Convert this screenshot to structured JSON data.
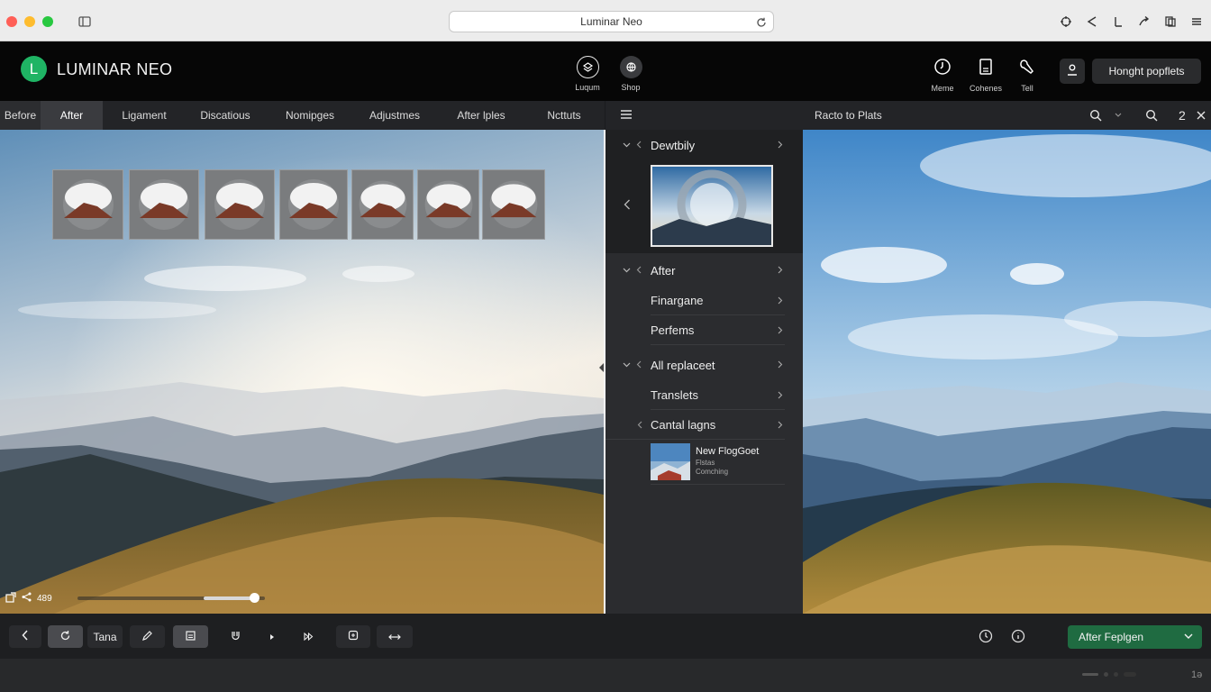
{
  "browser": {
    "url_title": "Luminar Neo",
    "icons": [
      "sidebar-icon",
      "reload-icon",
      "extensions-icon",
      "share-icon",
      "bookmark-icon",
      "forward-icon",
      "tabs-icon",
      "menu-icon"
    ]
  },
  "app": {
    "logo_letter": "L",
    "name": "LUMINAR NEO",
    "brand_color": "#1fb464",
    "center_tools": [
      {
        "label": "Luqum",
        "icon": "layers-icon"
      },
      {
        "label": "Shop",
        "icon": "globe-icon"
      }
    ],
    "right_tools": [
      {
        "label": "Meme",
        "icon": "history-icon"
      },
      {
        "label": "Cohenes",
        "icon": "document-icon"
      },
      {
        "label": "Tell",
        "icon": "brush-icon"
      }
    ],
    "account_icon": "user-icon",
    "primary_button": "Honght popflets"
  },
  "tabs": [
    {
      "label": "Before"
    },
    {
      "label": "After"
    },
    {
      "label": "Ligament"
    },
    {
      "label": "Discatious"
    },
    {
      "label": "Nomipges"
    },
    {
      "label": "Adjustmes"
    },
    {
      "label": "After lples"
    },
    {
      "label": "Ncttuts"
    }
  ],
  "canvas": {
    "thumbnail_count": 7,
    "zoom_value": "489",
    "zoom_level": 0.55
  },
  "panel": {
    "header_icon": "hamburger-icon",
    "section1": "Dewtbily",
    "section2": "After",
    "sub_rows_a": [
      "Finargane",
      "Perfems"
    ],
    "section3": "All replaceet",
    "sub_rows_b": [
      "Translets",
      "Cantal lagns"
    ],
    "item": {
      "title": "New FlogGoet",
      "line1": "Flstas",
      "line2": "Comching"
    }
  },
  "right_view": {
    "title": "Racto to Plats",
    "count": "2"
  },
  "bottom": {
    "tool_label": "Tana",
    "export_label": "After Feplgen",
    "export_color": "#1f6b41",
    "status_number": "1ə"
  }
}
